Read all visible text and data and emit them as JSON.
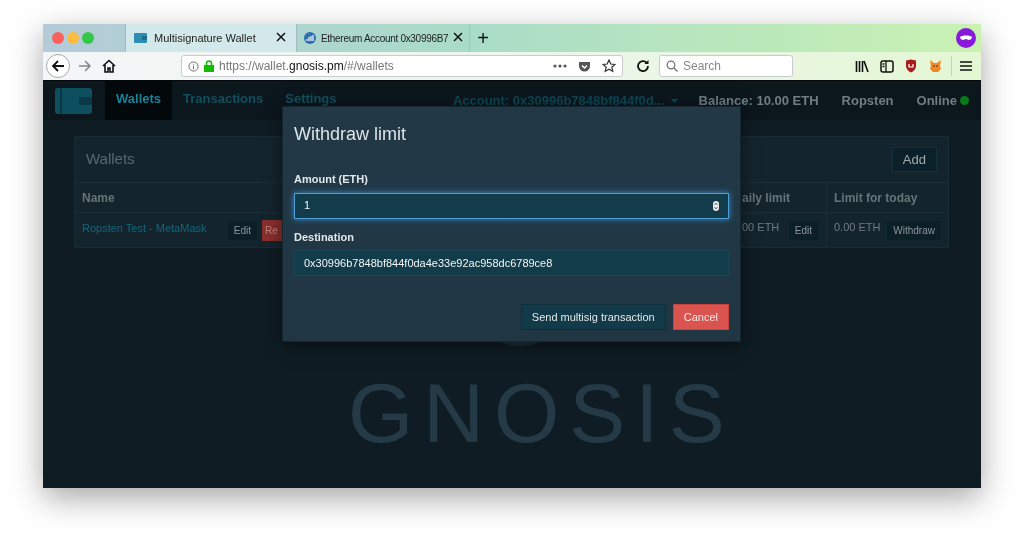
{
  "browser": {
    "tabs": [
      {
        "title": "Multisignature Wallet",
        "selected": true
      },
      {
        "title": "Ethereum Account 0x30996B7",
        "selected": false
      }
    ],
    "new_tab": "+",
    "url": {
      "prefix": "https://wallet.",
      "domain": "gnosis.pm",
      "path": "/#/wallets"
    },
    "search": {
      "placeholder": "Search"
    }
  },
  "app": {
    "nav": [
      {
        "label": "Wallets",
        "selected": true
      },
      {
        "label": "Transactions",
        "selected": false
      },
      {
        "label": "Settings",
        "selected": false
      }
    ],
    "account": "Account: 0x30996b7848bf844f0d...",
    "balance": "Balance: 10.00 ETH",
    "network": "Ropsten",
    "status": {
      "label": "Online",
      "online": true
    }
  },
  "wallets_panel": {
    "title": "Wallets",
    "add_button": "Add",
    "columns": [
      "Name",
      "aily limit",
      "Limit for today"
    ],
    "rows": [
      {
        "name": "Ropsten Test - MetaMask",
        "edit_button": "Edit",
        "remove_button": "Re",
        "daily_limit": "00 ETH",
        "daily_edit_button": "Edit",
        "limit_today": "0.00 ETH",
        "withdraw_button": "Withdraw"
      }
    ]
  },
  "background_logo": {
    "text": "GNOSIS"
  },
  "dialog": {
    "title": "Withdraw limit",
    "fields": [
      {
        "label": "Amount (ETH)",
        "value": "1",
        "kind": "number",
        "focused": true
      },
      {
        "label": "Destination",
        "value": "0x30996b7848bf844f0da4e33e92ac958dc6789ce8",
        "kind": "text",
        "focused": false
      }
    ],
    "buttons": [
      {
        "label": "Send multisig transaction",
        "kind": "primary"
      },
      {
        "label": "Cancel",
        "kind": "danger"
      }
    ]
  }
}
